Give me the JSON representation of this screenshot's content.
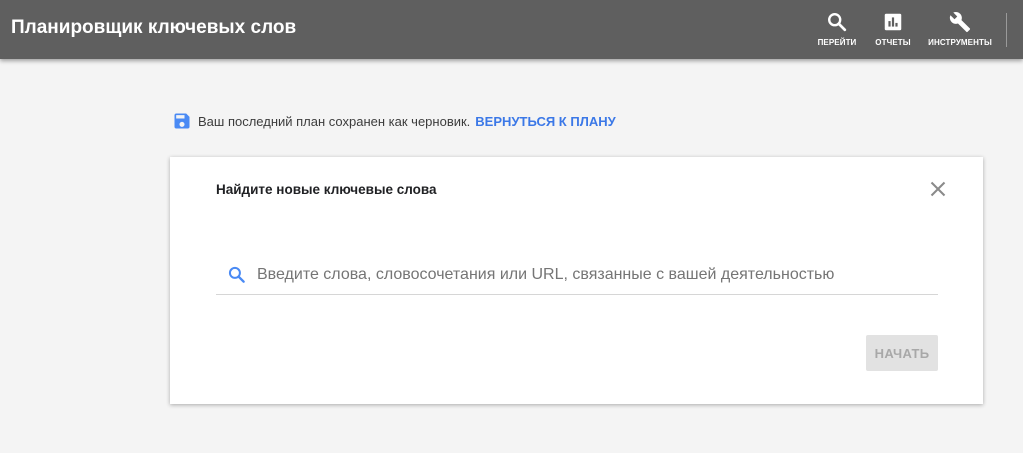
{
  "header": {
    "title": "Планировщик ключевых слов",
    "actions": [
      {
        "label": "ПЕРЕЙТИ",
        "icon": "search-icon"
      },
      {
        "label": "ОТЧЕТЫ",
        "icon": "bar-chart-icon"
      },
      {
        "label": "ИНСТРУМЕНТЫ",
        "icon": "wrench-icon"
      }
    ]
  },
  "notice": {
    "icon": "save-icon",
    "text": "Ваш последний план сохранен как черновик.",
    "link": "ВЕРНУТЬСЯ К ПЛАНУ"
  },
  "card": {
    "title": "Найдите новые ключевые слова",
    "close_icon": "close-icon",
    "search": {
      "placeholder": "Введите слова, словосочетания или URL, связанные с вашей деятельностью",
      "value": ""
    },
    "start_label": "НАЧАТЬ"
  },
  "colors": {
    "header_bg": "#5f5f5f",
    "page_bg": "#f4f4f4",
    "link": "#3b78e7",
    "accent_icon": "#4a8af4",
    "disabled_button_bg": "#e2e2e2",
    "disabled_button_text": "#a8a8a8"
  }
}
